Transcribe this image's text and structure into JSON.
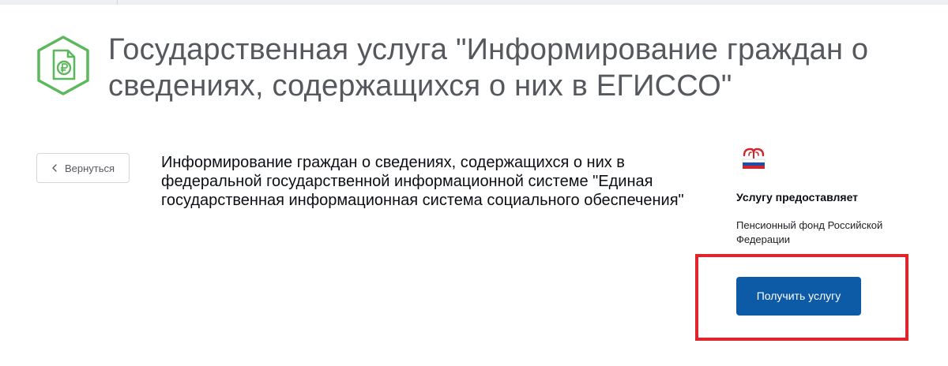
{
  "header": {
    "title": "Государственная услуга \"Информирование граждан о сведениях, содержащихся о них в ЕГИССО\"",
    "icon": "document-ruble-icon"
  },
  "navigation": {
    "back_label": "Вернуться"
  },
  "service": {
    "description": "Информирование граждан о сведениях, содержащихся о них в федеральной государственной информационной системе \"Единая государственная информационная система социального обеспечения\""
  },
  "provider": {
    "logo": "pfr-logo",
    "heading": "Услугу предоставляет",
    "name": "Пенсионный фонд Российской Федерации"
  },
  "actions": {
    "get_service_label": "Получить услугу"
  },
  "colors": {
    "accent_green": "#5cb85c",
    "button_blue": "#0d5aa7",
    "highlight_red": "#e0242b",
    "title_gray": "#55595e"
  }
}
